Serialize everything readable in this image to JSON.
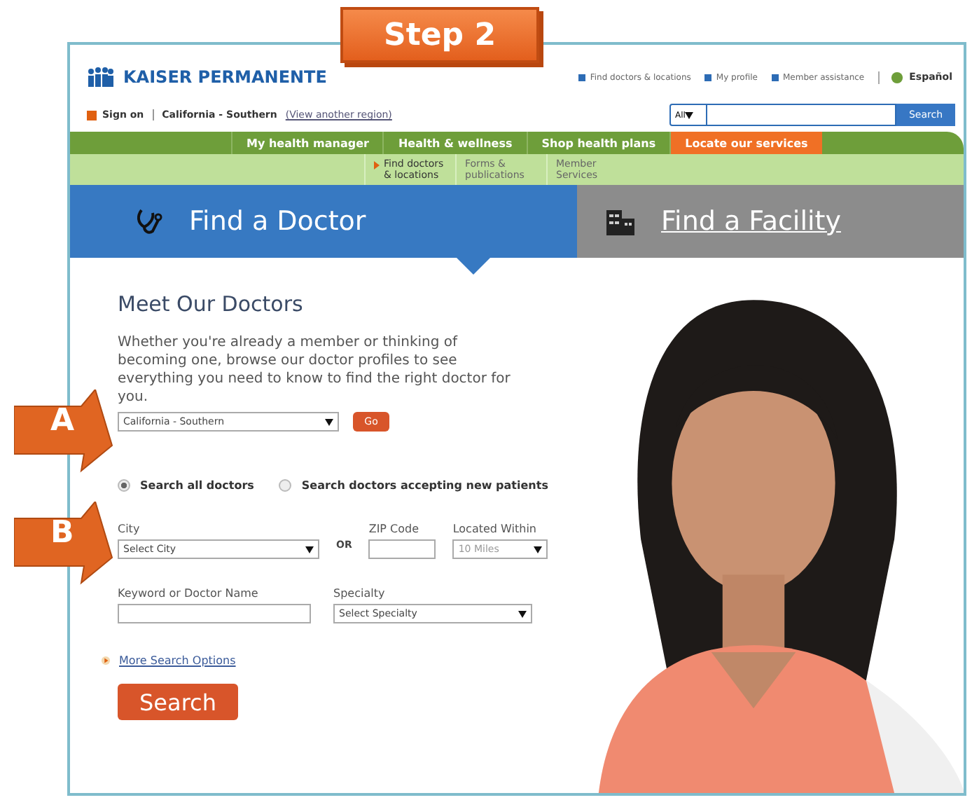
{
  "step_label": "Step 2",
  "callouts": [
    {
      "label": "A"
    },
    {
      "label": "B"
    }
  ],
  "header": {
    "logo": "KAISER PERMANENTE",
    "top_links": [
      "Find doctors & locations",
      "My profile",
      "Member assistance"
    ],
    "language": "Español"
  },
  "account_bar": {
    "sign_on": "Sign on",
    "region": "California - Southern",
    "region_link": "(View another region)",
    "search_scope": "All",
    "search_button": "Search"
  },
  "nav": [
    {
      "label": "My health manager",
      "selected": false
    },
    {
      "label": "Health & wellness",
      "selected": false
    },
    {
      "label": "Shop health plans",
      "selected": false
    },
    {
      "label": "Locate our services",
      "selected": true
    }
  ],
  "subnav": [
    {
      "label": "Find doctors & locations",
      "selected": true
    },
    {
      "label": "Forms & publications",
      "selected": false
    },
    {
      "label": "Member Services",
      "selected": false
    }
  ],
  "big_tabs": [
    {
      "label": "Find a Doctor",
      "kind": "doctor",
      "selected": true
    },
    {
      "label": "Find a Facility",
      "kind": "facility",
      "selected": false
    }
  ],
  "content": {
    "title": "Meet Our Doctors",
    "intro": "Whether you're already a member or thinking of becoming one, browse our doctor profiles to see everything you need to know to find the right doctor for you.",
    "region_select": "California - Southern",
    "go_button": "Go",
    "search_modes": [
      {
        "label": "Search all doctors",
        "selected": true
      },
      {
        "label": "Search doctors accepting new patients",
        "selected": false
      }
    ],
    "city_label": "City",
    "city_value": "Select City",
    "or_label": "OR",
    "zip_label": "ZIP Code",
    "within_label": "Located Within",
    "within_value": "10 Miles",
    "keyword_label": "Keyword or Doctor Name",
    "specialty_label": "Specialty",
    "specialty_value": "Select Specialty",
    "more_options": "More Search Options",
    "search_button": "Search"
  }
}
